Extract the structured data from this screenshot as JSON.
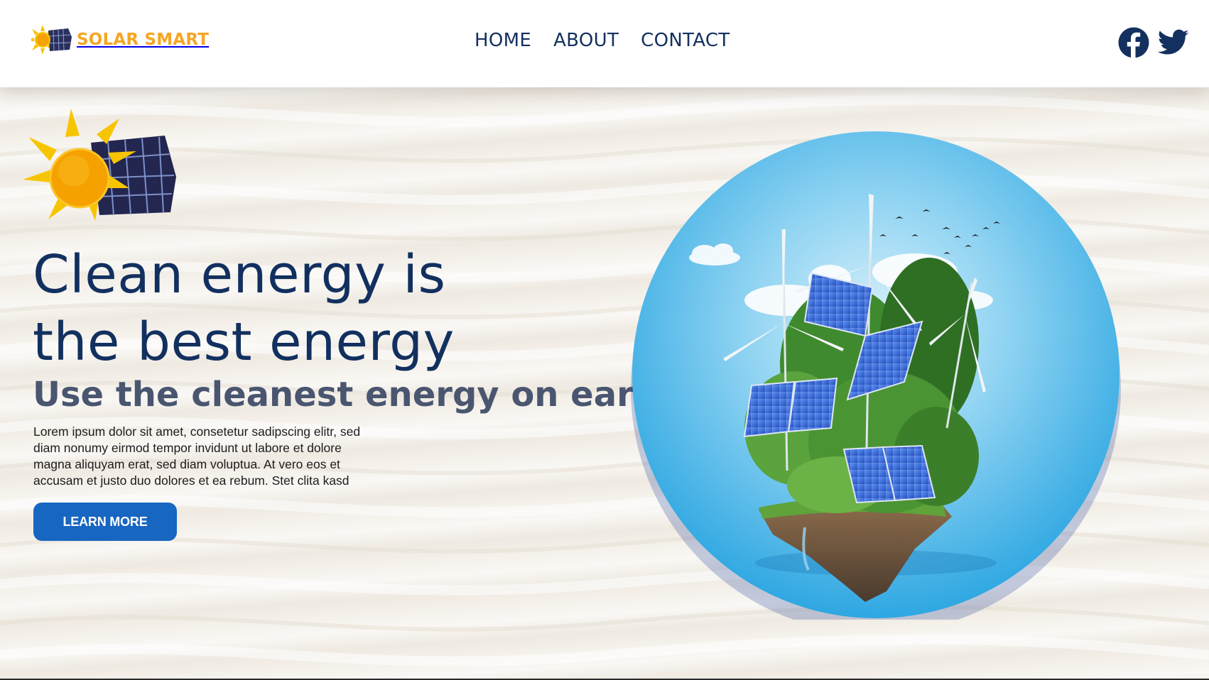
{
  "brand": {
    "name": "SOLAR SMART",
    "color": "#f5a623",
    "logo_icon": "sun-solar-panel-icon"
  },
  "nav": {
    "items": [
      {
        "label": "HOME"
      },
      {
        "label": "ABOUT"
      },
      {
        "label": "CONTACT"
      }
    ]
  },
  "social": {
    "icons": [
      "facebook-icon",
      "twitter-icon"
    ]
  },
  "hero": {
    "title_line1": "Clean energy is",
    "title_line2": "the best energy",
    "subtitle": "Use the cleanest energy on earth",
    "body": "Lorem ipsum dolor sit amet, consetetur sadipscing elitr, sed diam nonumy eirmod tempor invidunt ut labore et dolore magna aliquyam erat, sed diam voluptua. At vero eos et accusam et justo duo dolores et ea rebum. Stet clita kasd",
    "cta_label": "LEARN MORE",
    "image_icon": "floating-island-solar-wind-illustration"
  },
  "colors": {
    "navy": "#12305f",
    "accent_blue": "#1766c2",
    "sky_blue": "#3bb4e8",
    "sun_yellow": "#f5b800",
    "background": "#f3efe8"
  }
}
